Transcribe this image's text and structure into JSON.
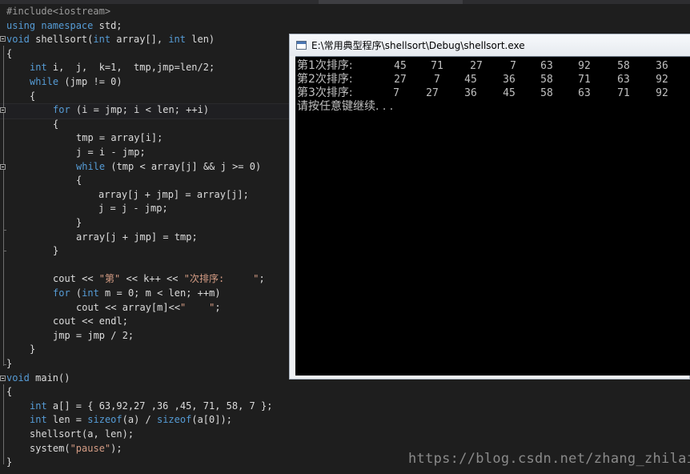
{
  "window": {
    "console_title": "E:\\常用典型程序\\shellsort\\Debug\\shellsort.exe"
  },
  "code": {
    "l01": "#include<iostream>",
    "l02_kw1": "using",
    "l02_kw2": "namespace",
    "l02_rest": " std;",
    "l03_kw": "void",
    "l03_a": " shellsort(",
    "l03_kw2": "int",
    "l03_b": " array[], ",
    "l03_kw3": "int",
    "l03_c": " len)",
    "l04": "{",
    "l05_kw": "int",
    "l05_rest": " i,  j,  k=1,  tmp,jmp=len/2;",
    "l06_kw": "while",
    "l06_rest": " (jmp != 0)",
    "l07": "{",
    "l08_kw": "for",
    "l08_rest": " (i = jmp; i < len; ++i)",
    "l09": "{",
    "l10": "tmp = array[i];",
    "l11": "j = i - jmp;",
    "l12_kw": "while",
    "l12_rest": " (tmp < array[j] && j >= 0)",
    "l13": "{",
    "l14": "array[j + jmp] = array[j];",
    "l15": "j = j - jmp;",
    "l16": "}",
    "l17": "array[j + jmp] = tmp;",
    "l18": "}",
    "l20_a": "cout << ",
    "l20_s1": "\"第\"",
    "l20_b": " << k++ << ",
    "l20_s2": "\"次排序:     \"",
    "l20_c": ";",
    "l21_kw": "for",
    "l21_a": " (",
    "l21_kw2": "int",
    "l21_b": " m = 0; m < len; ++m)",
    "l22_a": "cout << array[m]<<",
    "l22_s": "\"    \"",
    "l22_b": ";",
    "l23": "cout << endl;",
    "l24": "jmp = jmp / 2;",
    "l25": "}",
    "l26": "}",
    "l27_kw": "void",
    "l27_rest": " main()",
    "l28": "{",
    "l29_kw": "int",
    "l29_rest": " a[] = { 63,92,27 ,36 ,45, 71, 58, 7 };",
    "l30_kw": "int",
    "l30_a": " len = ",
    "l30_kw2": "sizeof",
    "l30_b": "(a) / ",
    "l30_kw3": "sizeof",
    "l30_c": "(a[0]);",
    "l31": "shellsort(a, len);",
    "l32_a": "system(",
    "l32_s": "\"pause\"",
    "l32_b": ");",
    "l33": "}"
  },
  "console_output": {
    "rows": [
      {
        "label": "第1次排序:",
        "values": [
          "45",
          "71",
          "27",
          "7",
          "63",
          "92",
          "58",
          "36"
        ]
      },
      {
        "label": "第2次排序:",
        "values": [
          "27",
          "7",
          "45",
          "36",
          "58",
          "71",
          "63",
          "92"
        ]
      },
      {
        "label": "第3次排序:",
        "values": [
          "7",
          "27",
          "36",
          "45",
          "58",
          "63",
          "71",
          "92"
        ]
      }
    ],
    "pause_text": "请按任意键继续. . ."
  },
  "watermark": "https://blog.csdn.net/zhang_zhilai",
  "colors": {
    "editor_bg": "#1e1e1e",
    "keyword": "#569cd6",
    "string": "#d69d85",
    "console_bg": "#000000",
    "console_text": "#c0c0c0"
  }
}
